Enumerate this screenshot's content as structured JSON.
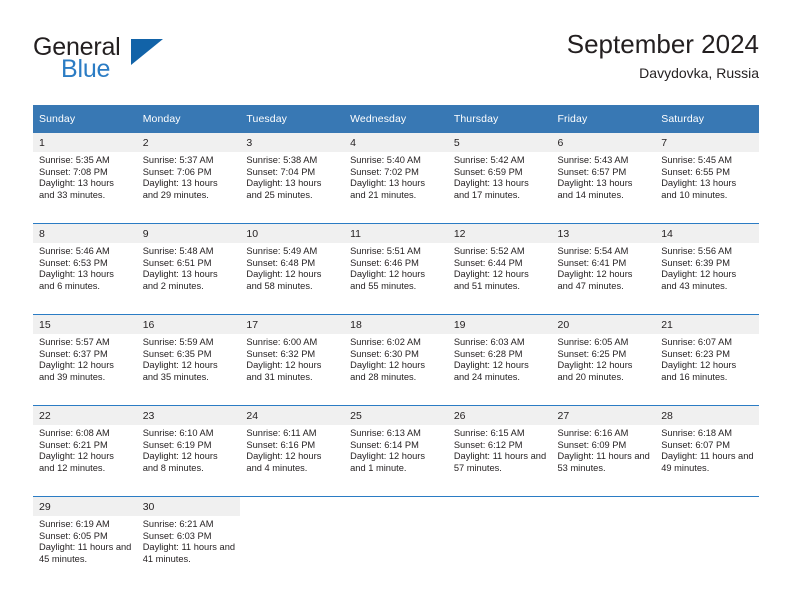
{
  "brand": {
    "name_part1": "General",
    "name_part2": "Blue",
    "logo_icon": "triangle-logo-icon"
  },
  "header": {
    "title": "September 2024",
    "subtitle": "Davydovka, Russia"
  },
  "colors": {
    "header_blue": "#3878b4",
    "accent_blue": "#2b7cc4",
    "logo_blue": "#1263a8",
    "daynum_bg": "#f0f0f0",
    "text": "#231f20"
  },
  "weekdays": [
    "Sunday",
    "Monday",
    "Tuesday",
    "Wednesday",
    "Thursday",
    "Friday",
    "Saturday"
  ],
  "weeks": [
    {
      "days": [
        {
          "num": "1",
          "sunrise": "Sunrise: 5:35 AM",
          "sunset": "Sunset: 7:08 PM",
          "daylight": "Daylight: 13 hours and 33 minutes."
        },
        {
          "num": "2",
          "sunrise": "Sunrise: 5:37 AM",
          "sunset": "Sunset: 7:06 PM",
          "daylight": "Daylight: 13 hours and 29 minutes."
        },
        {
          "num": "3",
          "sunrise": "Sunrise: 5:38 AM",
          "sunset": "Sunset: 7:04 PM",
          "daylight": "Daylight: 13 hours and 25 minutes."
        },
        {
          "num": "4",
          "sunrise": "Sunrise: 5:40 AM",
          "sunset": "Sunset: 7:02 PM",
          "daylight": "Daylight: 13 hours and 21 minutes."
        },
        {
          "num": "5",
          "sunrise": "Sunrise: 5:42 AM",
          "sunset": "Sunset: 6:59 PM",
          "daylight": "Daylight: 13 hours and 17 minutes."
        },
        {
          "num": "6",
          "sunrise": "Sunrise: 5:43 AM",
          "sunset": "Sunset: 6:57 PM",
          "daylight": "Daylight: 13 hours and 14 minutes."
        },
        {
          "num": "7",
          "sunrise": "Sunrise: 5:45 AM",
          "sunset": "Sunset: 6:55 PM",
          "daylight": "Daylight: 13 hours and 10 minutes."
        }
      ]
    },
    {
      "days": [
        {
          "num": "8",
          "sunrise": "Sunrise: 5:46 AM",
          "sunset": "Sunset: 6:53 PM",
          "daylight": "Daylight: 13 hours and 6 minutes."
        },
        {
          "num": "9",
          "sunrise": "Sunrise: 5:48 AM",
          "sunset": "Sunset: 6:51 PM",
          "daylight": "Daylight: 13 hours and 2 minutes."
        },
        {
          "num": "10",
          "sunrise": "Sunrise: 5:49 AM",
          "sunset": "Sunset: 6:48 PM",
          "daylight": "Daylight: 12 hours and 58 minutes."
        },
        {
          "num": "11",
          "sunrise": "Sunrise: 5:51 AM",
          "sunset": "Sunset: 6:46 PM",
          "daylight": "Daylight: 12 hours and 55 minutes."
        },
        {
          "num": "12",
          "sunrise": "Sunrise: 5:52 AM",
          "sunset": "Sunset: 6:44 PM",
          "daylight": "Daylight: 12 hours and 51 minutes."
        },
        {
          "num": "13",
          "sunrise": "Sunrise: 5:54 AM",
          "sunset": "Sunset: 6:41 PM",
          "daylight": "Daylight: 12 hours and 47 minutes."
        },
        {
          "num": "14",
          "sunrise": "Sunrise: 5:56 AM",
          "sunset": "Sunset: 6:39 PM",
          "daylight": "Daylight: 12 hours and 43 minutes."
        }
      ]
    },
    {
      "days": [
        {
          "num": "15",
          "sunrise": "Sunrise: 5:57 AM",
          "sunset": "Sunset: 6:37 PM",
          "daylight": "Daylight: 12 hours and 39 minutes."
        },
        {
          "num": "16",
          "sunrise": "Sunrise: 5:59 AM",
          "sunset": "Sunset: 6:35 PM",
          "daylight": "Daylight: 12 hours and 35 minutes."
        },
        {
          "num": "17",
          "sunrise": "Sunrise: 6:00 AM",
          "sunset": "Sunset: 6:32 PM",
          "daylight": "Daylight: 12 hours and 31 minutes."
        },
        {
          "num": "18",
          "sunrise": "Sunrise: 6:02 AM",
          "sunset": "Sunset: 6:30 PM",
          "daylight": "Daylight: 12 hours and 28 minutes."
        },
        {
          "num": "19",
          "sunrise": "Sunrise: 6:03 AM",
          "sunset": "Sunset: 6:28 PM",
          "daylight": "Daylight: 12 hours and 24 minutes."
        },
        {
          "num": "20",
          "sunrise": "Sunrise: 6:05 AM",
          "sunset": "Sunset: 6:25 PM",
          "daylight": "Daylight: 12 hours and 20 minutes."
        },
        {
          "num": "21",
          "sunrise": "Sunrise: 6:07 AM",
          "sunset": "Sunset: 6:23 PM",
          "daylight": "Daylight: 12 hours and 16 minutes."
        }
      ]
    },
    {
      "days": [
        {
          "num": "22",
          "sunrise": "Sunrise: 6:08 AM",
          "sunset": "Sunset: 6:21 PM",
          "daylight": "Daylight: 12 hours and 12 minutes."
        },
        {
          "num": "23",
          "sunrise": "Sunrise: 6:10 AM",
          "sunset": "Sunset: 6:19 PM",
          "daylight": "Daylight: 12 hours and 8 minutes."
        },
        {
          "num": "24",
          "sunrise": "Sunrise: 6:11 AM",
          "sunset": "Sunset: 6:16 PM",
          "daylight": "Daylight: 12 hours and 4 minutes."
        },
        {
          "num": "25",
          "sunrise": "Sunrise: 6:13 AM",
          "sunset": "Sunset: 6:14 PM",
          "daylight": "Daylight: 12 hours and 1 minute."
        },
        {
          "num": "26",
          "sunrise": "Sunrise: 6:15 AM",
          "sunset": "Sunset: 6:12 PM",
          "daylight": "Daylight: 11 hours and 57 minutes."
        },
        {
          "num": "27",
          "sunrise": "Sunrise: 6:16 AM",
          "sunset": "Sunset: 6:09 PM",
          "daylight": "Daylight: 11 hours and 53 minutes."
        },
        {
          "num": "28",
          "sunrise": "Sunrise: 6:18 AM",
          "sunset": "Sunset: 6:07 PM",
          "daylight": "Daylight: 11 hours and 49 minutes."
        }
      ]
    },
    {
      "days": [
        {
          "num": "29",
          "sunrise": "Sunrise: 6:19 AM",
          "sunset": "Sunset: 6:05 PM",
          "daylight": "Daylight: 11 hours and 45 minutes."
        },
        {
          "num": "30",
          "sunrise": "Sunrise: 6:21 AM",
          "sunset": "Sunset: 6:03 PM",
          "daylight": "Daylight: 11 hours and 41 minutes."
        },
        {
          "num": "",
          "sunrise": "",
          "sunset": "",
          "daylight": ""
        },
        {
          "num": "",
          "sunrise": "",
          "sunset": "",
          "daylight": ""
        },
        {
          "num": "",
          "sunrise": "",
          "sunset": "",
          "daylight": ""
        },
        {
          "num": "",
          "sunrise": "",
          "sunset": "",
          "daylight": ""
        },
        {
          "num": "",
          "sunrise": "",
          "sunset": "",
          "daylight": ""
        }
      ]
    }
  ]
}
